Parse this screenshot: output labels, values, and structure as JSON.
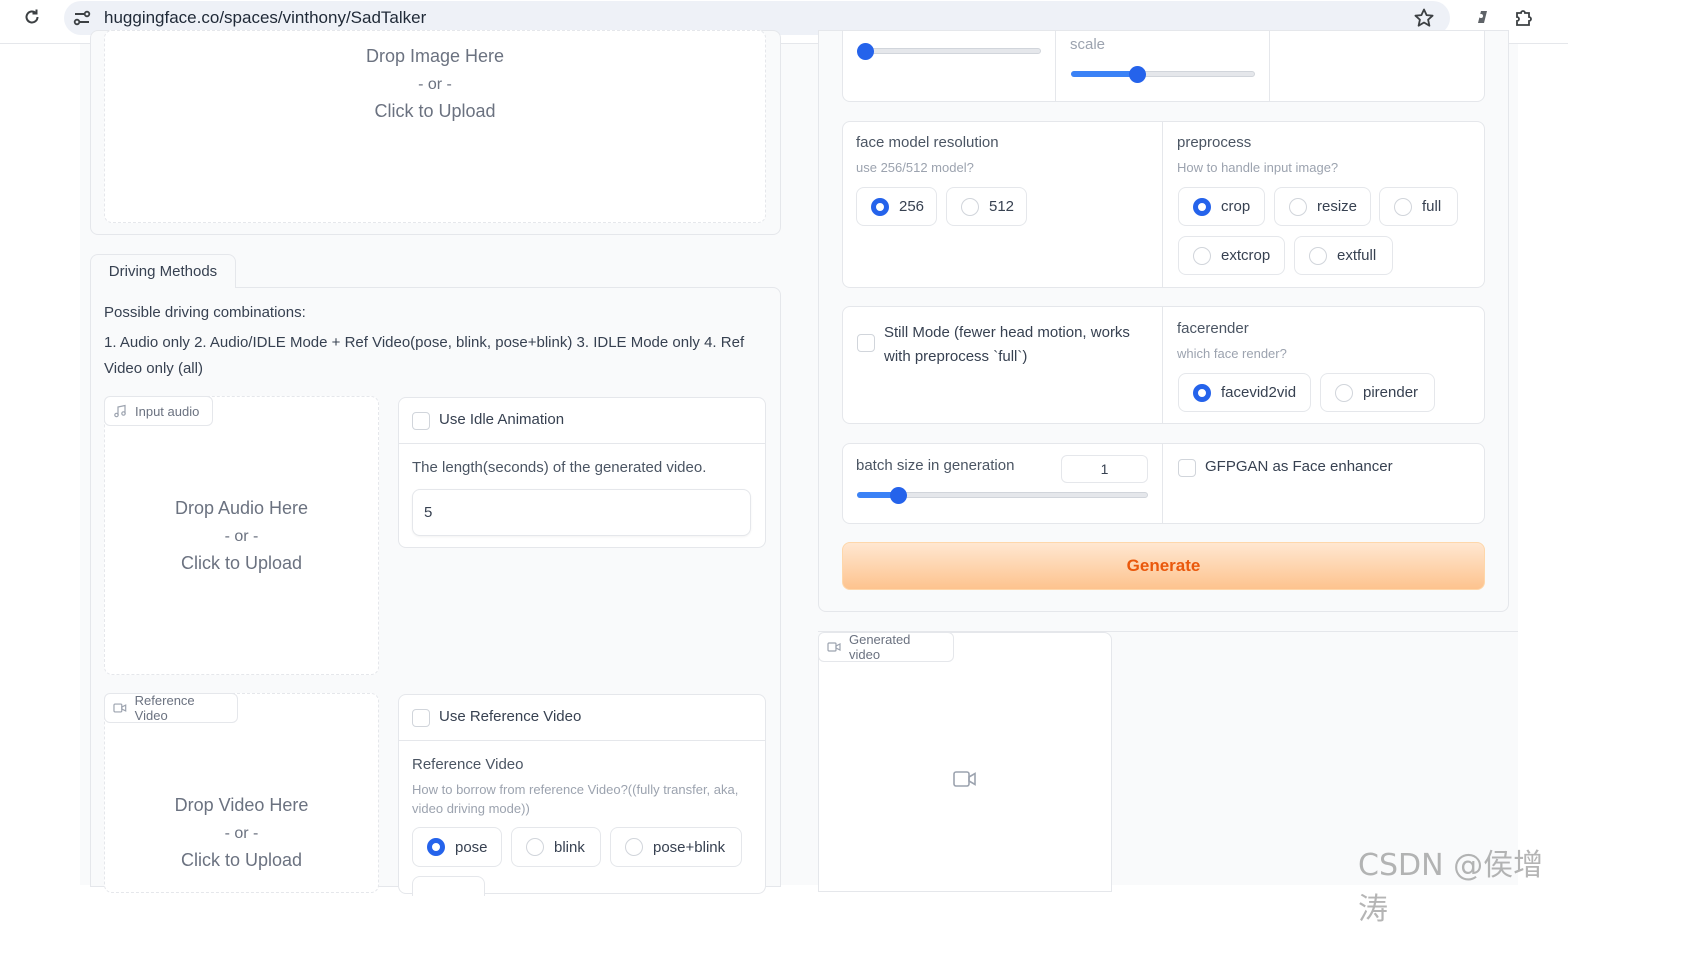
{
  "browser": {
    "url": "huggingface.co/spaces/vinthony/SadTalker",
    "icons": [
      "reload-icon",
      "site-settings-icon",
      "bookmark-star-icon",
      "extension-puzzle-icon",
      "profile-icon"
    ]
  },
  "image_upload": {
    "drop_text": "Drop Image Here",
    "or_text": "- or -",
    "click_text": "Click to Upload"
  },
  "driving": {
    "tab_label": "Driving Methods",
    "heading": "Possible driving combinations:",
    "description": "1. Audio only 2. Audio/IDLE Mode + Ref Video(pose, blink, pose+blink) 3. IDLE Mode only 4. Ref Video only (all)",
    "input_audio": {
      "tag": "Input audio",
      "drop_text": "Drop Audio Here",
      "or_text": "- or -",
      "click_text": "Click to Upload"
    },
    "idle": {
      "checkbox_label": "Use Idle Animation",
      "length_label": "The length(seconds) of the generated video.",
      "length_value": "5"
    },
    "reference_video_upload": {
      "tag": "Reference Video",
      "drop_text": "Drop Video Here",
      "or_text": "- or -",
      "click_text": "Click to Upload"
    },
    "ref_video": {
      "checkbox_label": "Use Reference Video",
      "label": "Reference Video",
      "info": "How to borrow from reference Video?((fully transfer, aka, video driving mode))",
      "options": [
        "pose",
        "blink",
        "pose+blink"
      ],
      "selected": "pose"
    }
  },
  "settings": {
    "scale_label": "scale",
    "top_slider_value": 0,
    "scale_slider_value": 0.35,
    "face_model": {
      "label": "face model resolution",
      "info": "use 256/512 model?",
      "options": [
        "256",
        "512"
      ],
      "selected": "256"
    },
    "preprocess": {
      "label": "preprocess",
      "info": "How to handle input image?",
      "options": [
        "crop",
        "resize",
        "full",
        "extcrop",
        "extfull"
      ],
      "selected": "crop"
    },
    "still_mode": {
      "label_line1": "Still Mode (fewer head motion, works",
      "label_line2": "with preprocess `full`)"
    },
    "facerender": {
      "label": "facerender",
      "info": "which face render?",
      "options": [
        "facevid2vid",
        "pirender"
      ],
      "selected": "facevid2vid"
    },
    "batch": {
      "label": "batch size in generation",
      "value": "1",
      "slider_value": 0.12
    },
    "gfpgan_label": "GFPGAN as Face enhancer",
    "generate_label": "Generate"
  },
  "output": {
    "tag": "Generated video"
  },
  "watermark": "CSDN @侯增涛",
  "colors": {
    "accent": "#2563eb",
    "generate_from": "#fed7aa",
    "generate_to": "#fdba74",
    "generate_text": "#ea580c"
  }
}
